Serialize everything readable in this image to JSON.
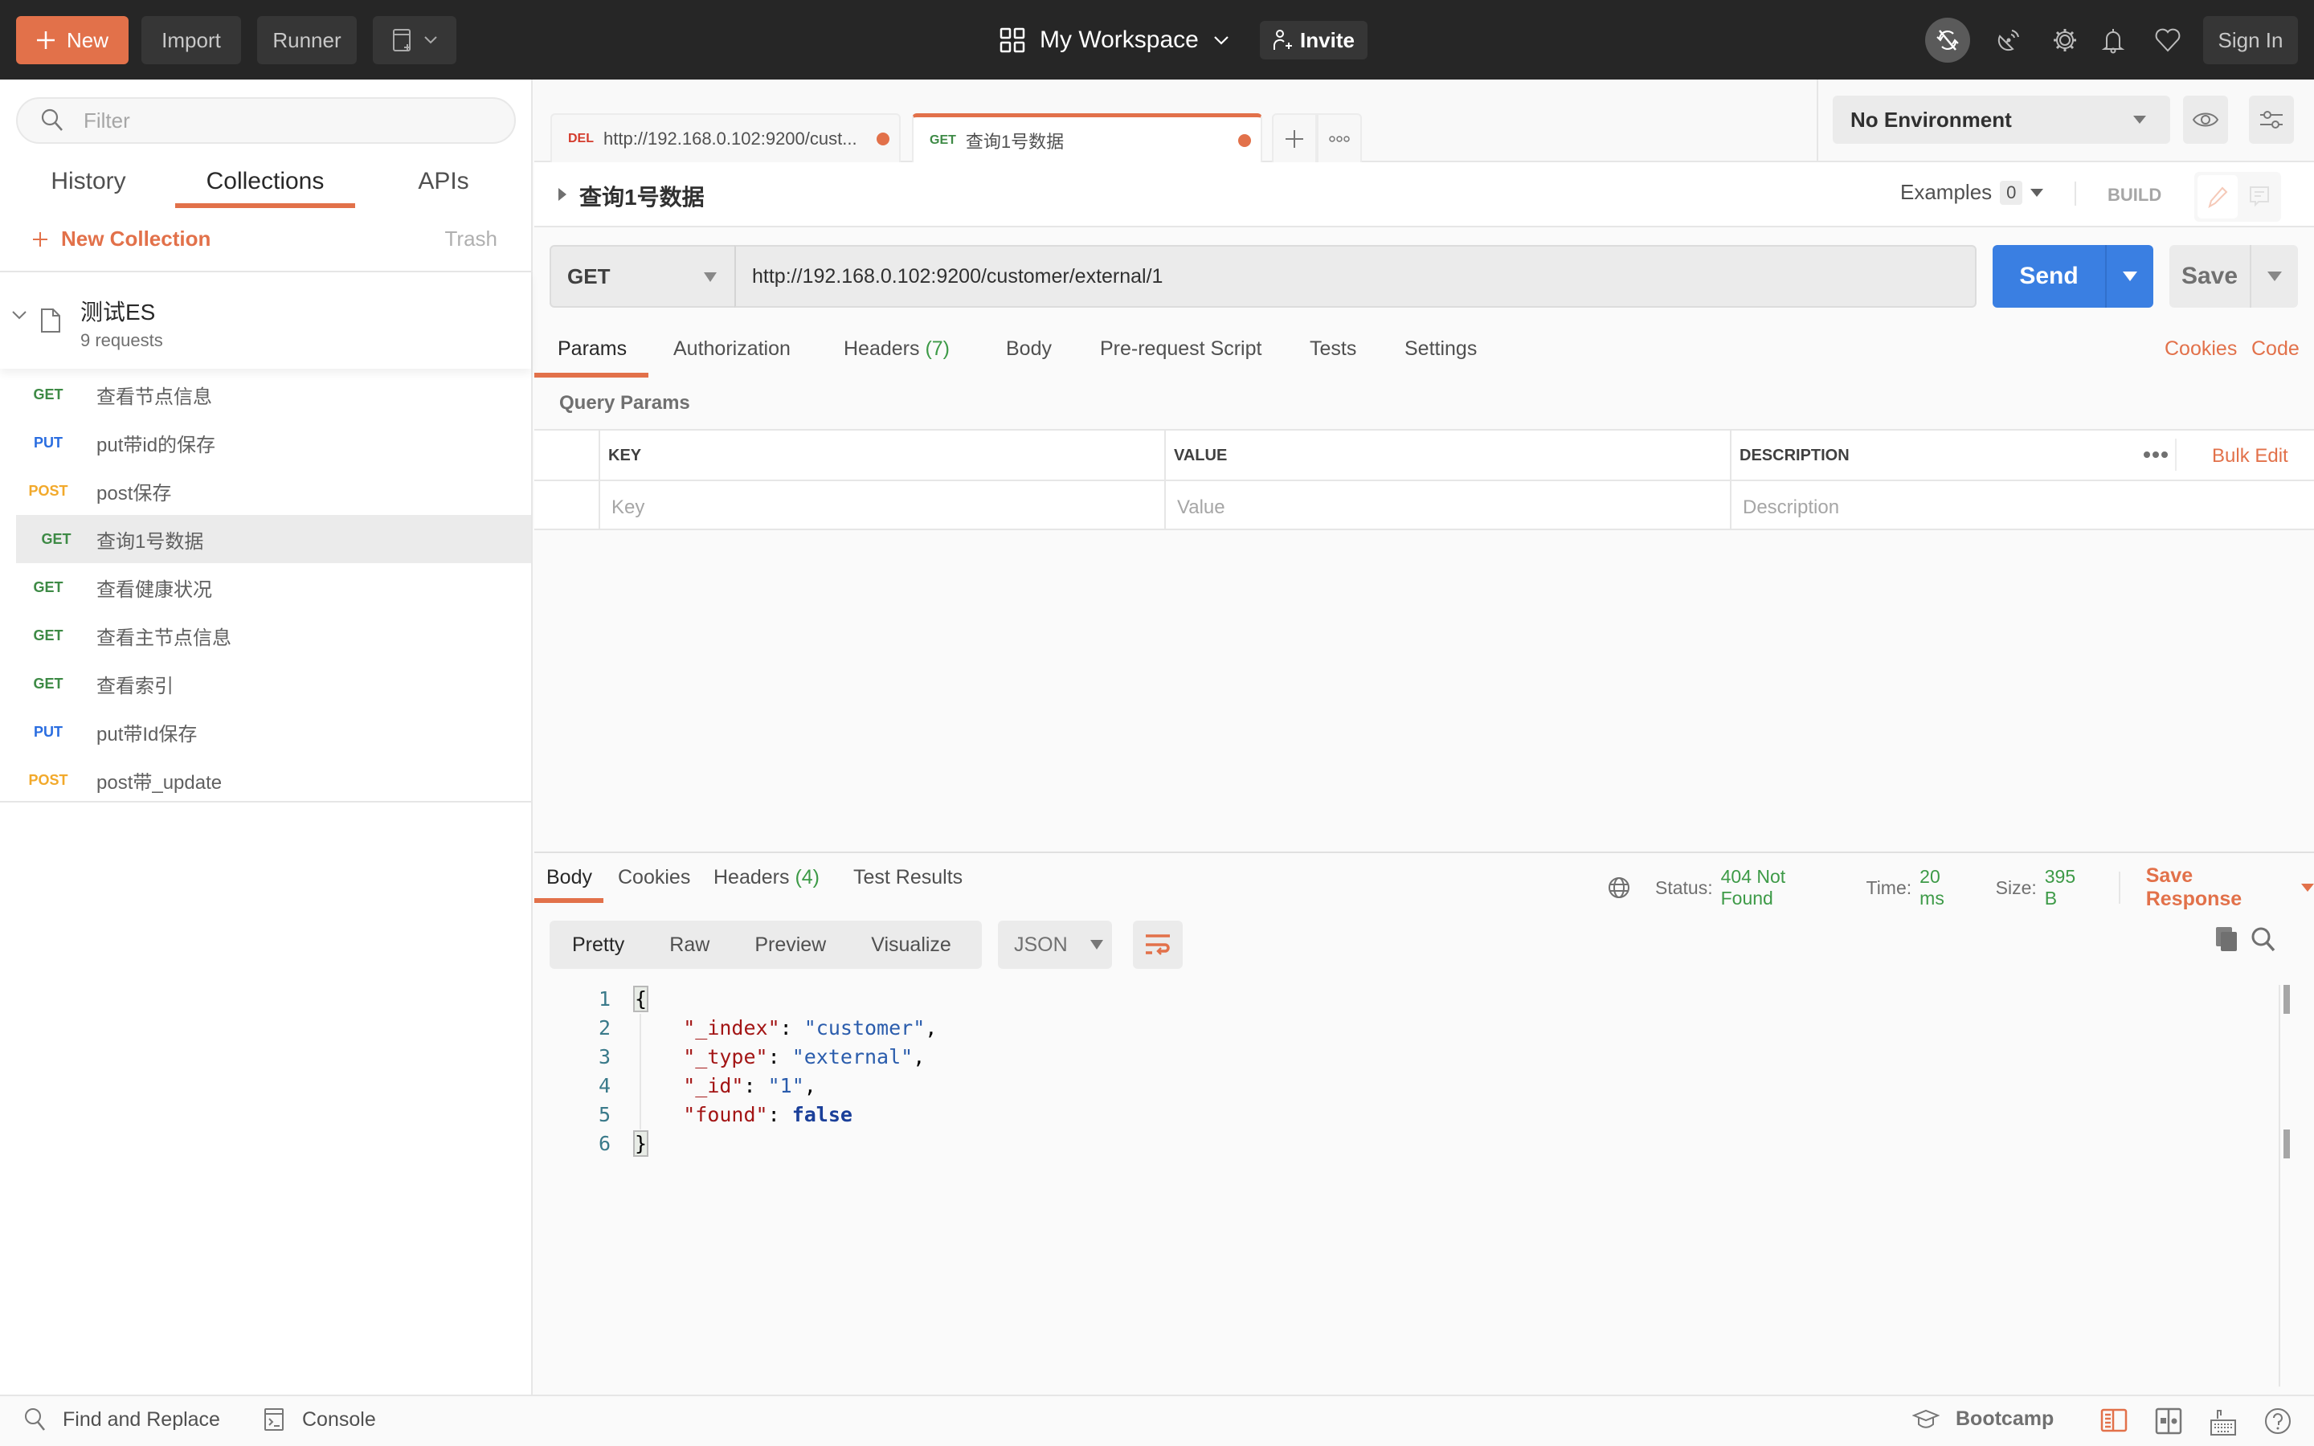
{
  "topbar": {
    "new_label": "New",
    "import_label": "Import",
    "runner_label": "Runner",
    "workspace_label": "My Workspace",
    "invite_label": "Invite",
    "signin_label": "Sign In",
    "icons": [
      "plus-icon",
      "new-window-icon",
      "workspace-grid-icon",
      "chevron-down-icon",
      "add-user-icon",
      "sync-off-icon",
      "satellite-icon",
      "gear-icon",
      "bell-icon",
      "heart-icon"
    ]
  },
  "sidebar": {
    "filter_placeholder": "Filter",
    "tabs": [
      {
        "label": "History",
        "active": false
      },
      {
        "label": "Collections",
        "active": true
      },
      {
        "label": "APIs",
        "active": false
      }
    ],
    "new_collection_label": "New Collection",
    "trash_label": "Trash",
    "collection": {
      "name": "测试ES",
      "count": "9 requests",
      "requests": [
        {
          "method": "GET",
          "name": "查看节点信息",
          "selected": false
        },
        {
          "method": "PUT",
          "name": "put带id的保存",
          "selected": false
        },
        {
          "method": "POST",
          "name": "post保存",
          "selected": false
        },
        {
          "method": "GET",
          "name": "查询1号数据",
          "selected": true
        },
        {
          "method": "GET",
          "name": "查看健康状况",
          "selected": false
        },
        {
          "method": "GET",
          "name": "查看主节点信息",
          "selected": false
        },
        {
          "method": "GET",
          "name": "查看索引",
          "selected": false
        },
        {
          "method": "PUT",
          "name": "put带Id保存",
          "selected": false
        },
        {
          "method": "POST",
          "name": "post带_update",
          "selected": false
        }
      ]
    }
  },
  "method_colors": {
    "GET": "#3d8a45",
    "PUT": "#2a6de0",
    "POST": "#f2a92b",
    "DEL": "#d43b2c"
  },
  "request_tabs": [
    {
      "method": "DEL",
      "title": "http://192.168.0.102:9200/cust...",
      "unsaved": true,
      "active": false
    },
    {
      "method": "GET",
      "title": "查询1号数据",
      "unsaved": true,
      "active": true
    }
  ],
  "environment": {
    "selected": "No Environment"
  },
  "request": {
    "title": "查询1号数据",
    "examples_label": "Examples",
    "examples_count": "0",
    "build_label": "BUILD",
    "method": "GET",
    "url": "http://192.168.0.102:9200/customer/external/1",
    "send_label": "Send",
    "save_label": "Save",
    "tabs": [
      {
        "label": "Params",
        "count": "",
        "active": true
      },
      {
        "label": "Authorization",
        "count": "",
        "active": false
      },
      {
        "label": "Headers",
        "count": "(7)",
        "active": false
      },
      {
        "label": "Body",
        "count": "",
        "active": false
      },
      {
        "label": "Pre-request Script",
        "count": "",
        "active": false
      },
      {
        "label": "Tests",
        "count": "",
        "active": false
      },
      {
        "label": "Settings",
        "count": "",
        "active": false
      }
    ],
    "cookies_label": "Cookies",
    "code_label": "Code",
    "query_params_label": "Query Params",
    "params_table": {
      "headers": [
        "KEY",
        "VALUE",
        "DESCRIPTION"
      ],
      "placeholders": [
        "Key",
        "Value",
        "Description"
      ],
      "bulk_edit_label": "Bulk Edit"
    }
  },
  "response": {
    "tabs": [
      {
        "label": "Body",
        "count": "",
        "active": true
      },
      {
        "label": "Cookies",
        "count": "",
        "active": false
      },
      {
        "label": "Headers",
        "count": "(4)",
        "active": false
      },
      {
        "label": "Test Results",
        "count": "",
        "active": false
      }
    ],
    "status_label": "Status:",
    "status_value": "404 Not Found",
    "time_label": "Time:",
    "time_value": "20 ms",
    "size_label": "Size:",
    "size_value": "395 B",
    "save_response_label": "Save Response",
    "view_modes": [
      {
        "label": "Pretty",
        "active": true
      },
      {
        "label": "Raw",
        "active": false
      },
      {
        "label": "Preview",
        "active": false
      },
      {
        "label": "Visualize",
        "active": false
      }
    ],
    "format": "JSON",
    "body_lines": [
      {
        "n": "1",
        "key": "",
        "value": "",
        "type": "open"
      },
      {
        "n": "2",
        "key": "\"_index\"",
        "value": "\"customer\"",
        "type": "string",
        "comma": true
      },
      {
        "n": "3",
        "key": "\"_type\"",
        "value": "\"external\"",
        "type": "string",
        "comma": true
      },
      {
        "n": "4",
        "key": "\"_id\"",
        "value": "\"1\"",
        "type": "string",
        "comma": true
      },
      {
        "n": "5",
        "key": "\"found\"",
        "value": "false",
        "type": "bool",
        "comma": false
      },
      {
        "n": "6",
        "key": "",
        "value": "",
        "type": "close"
      }
    ]
  },
  "footer": {
    "find_replace_label": "Find and Replace",
    "console_label": "Console",
    "bootcamp_label": "Bootcamp"
  },
  "colors": {
    "accent": "#e2714a",
    "send": "#3a7fe2",
    "success": "#3d9a47",
    "topbar": "#262626"
  }
}
